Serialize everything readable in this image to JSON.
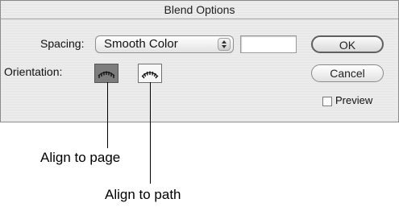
{
  "dialog": {
    "title": "Blend Options",
    "spacing_label": "Spacing:",
    "spacing_value": "Smooth Color",
    "spacing_amount": "",
    "orientation_label": "Orientation:",
    "ok_label": "OK",
    "cancel_label": "Cancel",
    "preview_label": "Preview",
    "preview_checked": false
  },
  "callouts": {
    "align_page": "Align to page",
    "align_path": "Align to path"
  }
}
